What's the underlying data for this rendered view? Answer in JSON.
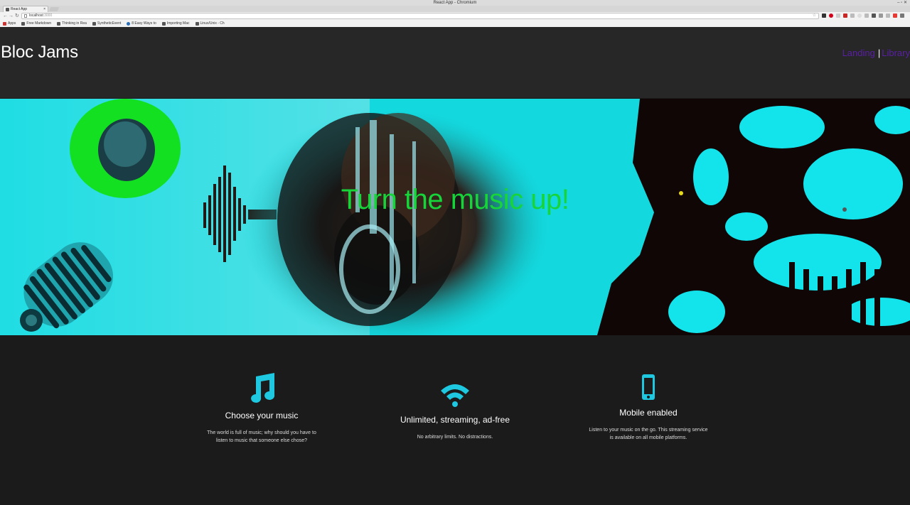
{
  "browser": {
    "window_title": "React App - Chromium",
    "tab_title": "React App",
    "url_host": "localhost",
    "url_port": ":3000",
    "bookmarks": [
      "Apps",
      "Free Markdown",
      "Thinking in Rea",
      "SyntheticEvent",
      "8 Easy Ways to",
      "Importing Mac",
      "Linux/Unix - Ch"
    ]
  },
  "navbar": {
    "brand": "Bloc Jams",
    "links": {
      "landing": "Landing",
      "separator": "|",
      "library": "Library"
    }
  },
  "hero": {
    "title": "Turn the music up!"
  },
  "features": [
    {
      "icon": "music-note-icon",
      "title": "Choose your music",
      "text_lines": [
        "The world is full of music; why should you have to",
        "listen to music that someone else chose?"
      ]
    },
    {
      "icon": "wifi-icon",
      "title": "Unlimited, streaming, ad-free",
      "text_lines": [
        "No arbitrary limits. No distractions."
      ]
    },
    {
      "icon": "mobile-phone-icon",
      "title": "Mobile enabled",
      "text_lines": [
        "Listen to your music on the go. This streaming service",
        "is available on all mobile platforms."
      ]
    }
  ],
  "colors": {
    "page_bg": "#1b1b1b",
    "navbar_bg": "#272727",
    "link": "#5a1fa6",
    "hero_title": "#16d43a",
    "icon_accent": "#1ec8e0",
    "hero_cyan": "#0fd6dc"
  }
}
